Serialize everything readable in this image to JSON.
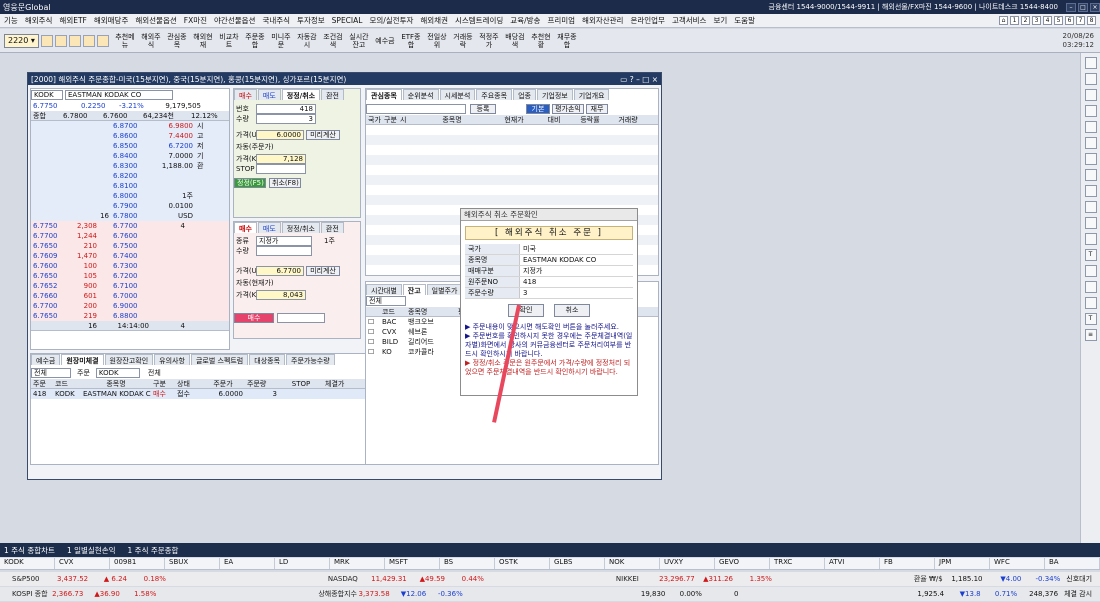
{
  "app": {
    "title": "영웅문Global",
    "center_info": "금융센터 1544-9000/1544-9911 | 해외선물/FX마진 1544-9600 | 나이트데스크 1544-8400"
  },
  "menu": [
    "기능",
    "해외주식",
    "해외ETF",
    "해외매당주",
    "해외선물옵션",
    "FX마진",
    "야간선물옵션",
    "국내주식",
    "투자정보",
    "SPECIAL",
    "모의/실전투자",
    "해외채권",
    "시스템트레이딩",
    "교육/방송",
    "프리미엄",
    "해외자산관리",
    "온라인업무",
    "고객서비스",
    "보기",
    "도움말"
  ],
  "toolbar": {
    "screen_no": "2220",
    "buttons": [
      "추천메뉴",
      "해외주식",
      "관심종목",
      "해외현재",
      "비교차트",
      "주문종합",
      "미니주문",
      "자동감시",
      "조건검색",
      "실시간잔고",
      "예수금",
      "ETF종합",
      "전일상위",
      "거래등락",
      "적정주가",
      "배당검색",
      "추천현황",
      "재무종합"
    ],
    "date": "20/08/26",
    "time": "03:29:12"
  },
  "window": {
    "title": "[2000] 해외주식 주문종합-미국(15분지연), 중국(15분지연), 홍콩(15분지연), 싱가포르(15분지연)"
  },
  "quote": {
    "code": "KODK",
    "name": "EASTMAN KODAK CO",
    "price": "6.7750",
    "change": "0.2250",
    "rate": "-3.21%",
    "volume": "9,179,505",
    "label": "종합",
    "prev": "6.7800",
    "open": "6.7600",
    "amount": "64,234천",
    "pct": "12.12%"
  },
  "asks": [
    [
      "6.8700",
      "6.9800",
      "시"
    ],
    [
      "6.8600",
      "7.4400",
      "고"
    ],
    [
      "6.8500",
      "6.7200",
      "저"
    ],
    [
      "6.8400",
      "7.0000",
      "기"
    ],
    [
      "6.8300",
      "1,188.00",
      "환"
    ],
    [
      "6.8200",
      "",
      ""
    ],
    [
      "6.8100",
      "",
      ""
    ],
    [
      "6.8000",
      "1주",
      ""
    ],
    [
      "6.7900",
      "0.0100",
      ""
    ],
    [
      "6.7800",
      "USD",
      ""
    ]
  ],
  "askqty": [
    "16"
  ],
  "bids": [
    [
      "6.7750",
      "2,308",
      "6.7700",
      "4"
    ],
    [
      "6.7700",
      "1,244",
      "6.7600",
      ""
    ],
    [
      "6.7650",
      "210",
      "6.7500",
      ""
    ],
    [
      "6.7609",
      "1,470",
      "6.7400",
      ""
    ],
    [
      "6.7600",
      "100",
      "6.7300",
      ""
    ],
    [
      "6.7650",
      "105",
      "6.7200",
      ""
    ],
    [
      "6.7652",
      "900",
      "6.7100",
      ""
    ],
    [
      "6.7660",
      "601",
      "6.7000",
      ""
    ],
    [
      "6.7700",
      "200",
      "6.9000",
      ""
    ],
    [
      "6.7650",
      "219",
      "6.8800",
      ""
    ]
  ],
  "bid_footer": {
    "qty": "16",
    "time": "14:14:00",
    "qty2": "4"
  },
  "order": {
    "tabs": [
      "매수",
      "매도",
      "정정/취소",
      "환전"
    ],
    "orderno_label": "번호",
    "orderno": "418",
    "qty_label": "수량",
    "qty": "3",
    "price_label": "가격(USD)",
    "price": "6.0000",
    "preview": "미리계산",
    "auto": "자동(주문가)",
    "krw_label": "가격(KRW)",
    "krw": "7,128",
    "stop_label": "STOP",
    "submit": "정정(F5)",
    "cancel": "취소(F8)"
  },
  "order2": {
    "tabs": [
      "매수",
      "매도",
      "정정/취소",
      "환전"
    ],
    "type_label": "종류",
    "type": "지정가",
    "qty_label": "수량",
    "unit": "1주",
    "price": "6.7700",
    "auto": "자동(현재가)",
    "krw": "8,043",
    "submit": "매수"
  },
  "watch": {
    "tabs": [
      "관심종목",
      "순위분석",
      "시세분석",
      "주요종목",
      "업종",
      "기업정보",
      "기업개요"
    ],
    "buttons": [
      "등록",
      "기본",
      "평가손익",
      "재무"
    ],
    "headers": [
      "국가",
      "구분",
      "시",
      "종목명",
      "현재가",
      "대비",
      "등락률",
      "거래량"
    ]
  },
  "bottom_left": {
    "tabs": [
      "예수금",
      "원장미체결",
      "원장잔고확인",
      "유의사항",
      "글로벌 스펙트럼",
      "대상종목",
      "주문가능수량"
    ],
    "filters": [
      "전체",
      "주문",
      "전체"
    ],
    "headers": [
      "주문",
      "코드",
      "종목명",
      "구분",
      "상태",
      "주문가",
      "주문량",
      "STOP",
      "체결가"
    ],
    "rows": [
      [
        "418",
        "KODK",
        "EASTMAN KODAK CO",
        "매수",
        "접수",
        "6.0000",
        "3",
        "",
        ""
      ]
    ]
  },
  "bottom_right": {
    "tabs": [
      "시간대별",
      "잔고",
      "일별주가"
    ],
    "exchange": "전체",
    "headers": [
      "코드",
      "종목명",
      "평"
    ],
    "rows": [
      [
        "BAC",
        "뱅크오브"
      ],
      [
        "CVX",
        "쉐브론"
      ],
      [
        "BILD",
        "길리어드"
      ],
      [
        "KO",
        "코카콜라"
      ]
    ]
  },
  "dialog": {
    "title": "해외주식 취소 주문확인",
    "heading": "[ 해외주식 취소 주문 ]",
    "rows": [
      [
        "국가",
        "미국"
      ],
      [
        "종목명",
        "EASTMAN KODAK CO"
      ],
      [
        "매매구분",
        "지정가"
      ],
      [
        "원주문NO",
        "418"
      ],
      [
        "주문수량",
        "3"
      ]
    ],
    "confirm": "확인",
    "cancel": "취소",
    "notice1": "▶ 주문내용이 맞으시면 해도확인 버튼을 눌러주세요.",
    "notice2": "▶ 주문번호를 확인하시지 못한 경우에는 주문체결내역(일자별)화면에서 당사의 커뮤금융센터로 주문처리여부를 반드시 확인하시기 바랍니다.",
    "notice3": "▶ 정정/취소 주문은 원주문에서 가격/수량에 정정처리 되었으면 주문체결내역을 반드시 확인하시기 바랍니다."
  },
  "bottomtabs": [
    "1 주식 종합차트",
    "1 일별실현손익",
    "1 주식 주문종합"
  ],
  "tickers": [
    "KODK",
    "CVX",
    "00981",
    "SBUX",
    "EA",
    "LD",
    "MRK",
    "MSFT",
    "BS",
    "OSTK",
    "GLBS",
    "NOK",
    "UVXY",
    "GEVO",
    "TRXC",
    "ATVI",
    "FB",
    "JPM",
    "WFC",
    "BA"
  ],
  "index1": [
    [
      "S&P500",
      "3,437.52",
      "▲ 6.24",
      "0.18%"
    ],
    [
      "NASDAQ",
      "11,429.31",
      "▲49.59",
      "0.44%"
    ],
    [
      "NIKKEI",
      "23,296.77",
      "▲311.26",
      "1.35%"
    ],
    [
      "환율 ₩/$",
      "1,185.10",
      "▼4.00",
      "-0.34%"
    ]
  ],
  "index2": [
    [
      "KOSPI 종합",
      "2,366.73",
      "▲36.90",
      "1.58%"
    ],
    [
      "상해종합지수",
      "3,373.58",
      "▼12.06",
      "-0.36%"
    ],
    [
      "",
      "19,830",
      "0.00%",
      "0"
    ],
    [
      "",
      "1,925.4",
      "▼13.8",
      "0.71%"
    ]
  ],
  "index_extra": [
    "248,376",
    "신호대기",
    "체결 감시"
  ]
}
